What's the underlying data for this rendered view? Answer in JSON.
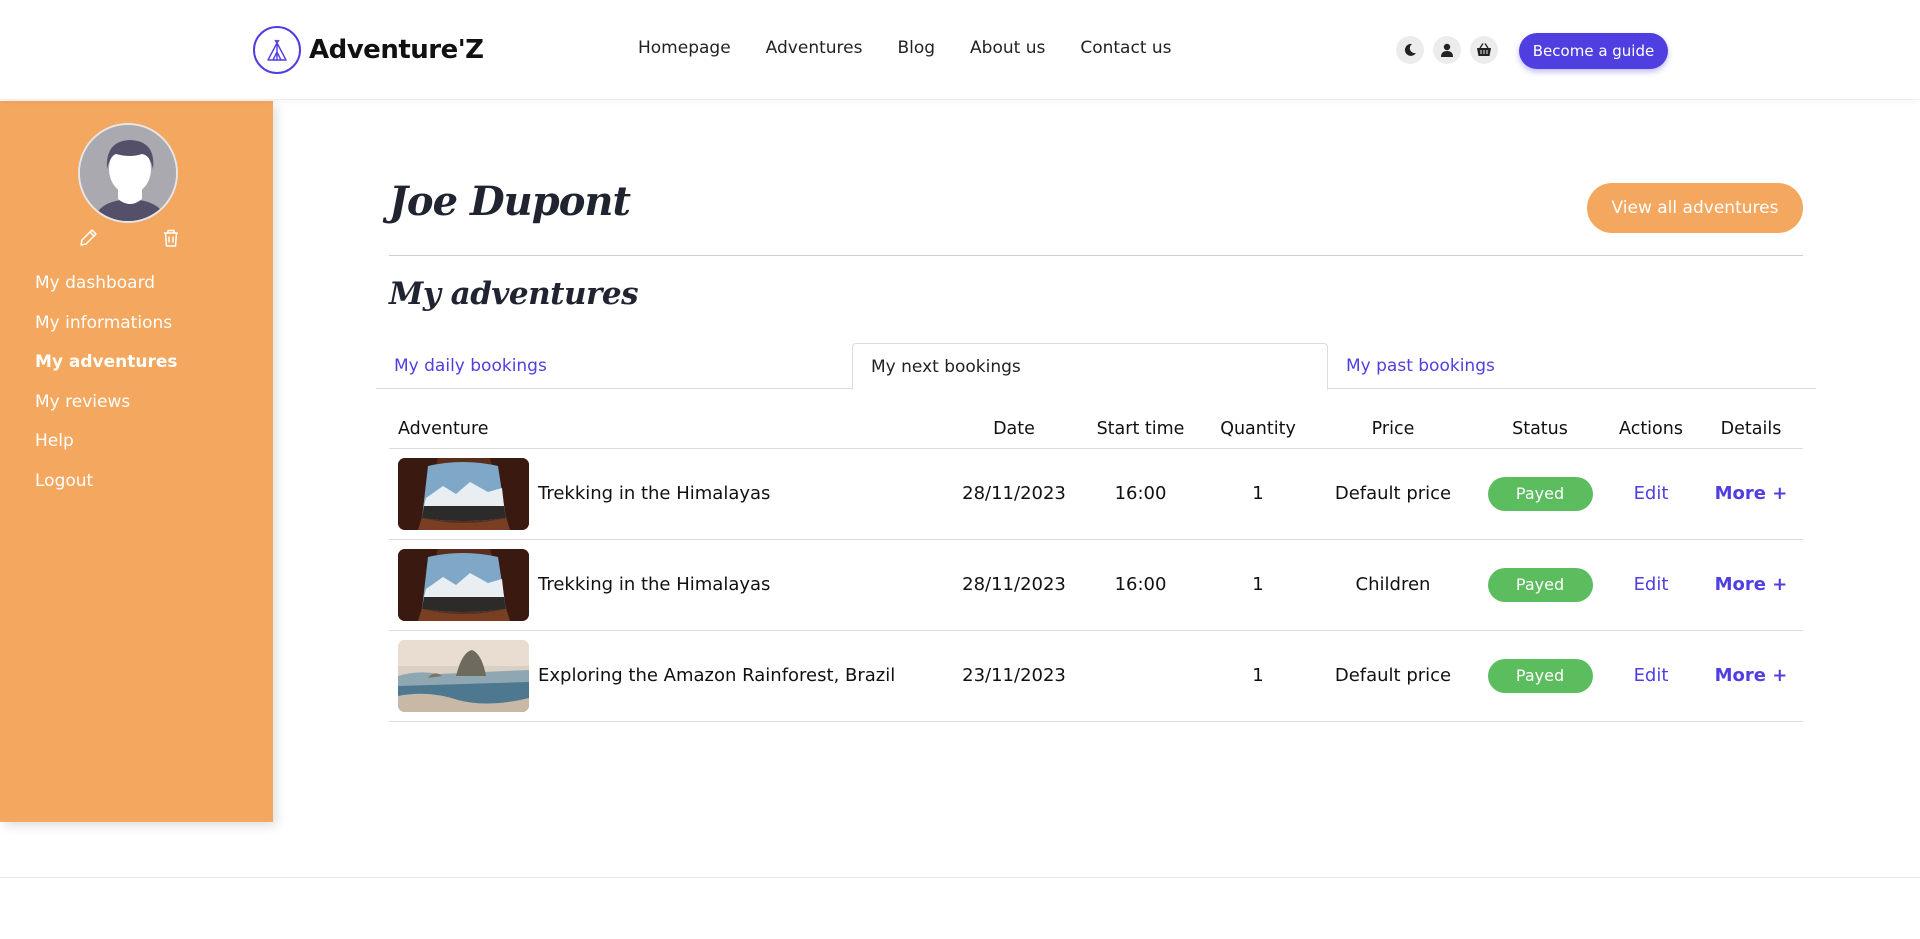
{
  "brand": {
    "name": "Adventure'Z",
    "accent": "#4f3fe0",
    "orange": "#f3a75f"
  },
  "nav": {
    "items": [
      "Homepage",
      "Adventures",
      "Blog",
      "About us",
      "Contact us"
    ]
  },
  "header_icons": [
    "moon-icon",
    "user-icon",
    "basket-icon"
  ],
  "cta": {
    "become_guide": "Become a guide"
  },
  "sidebar": {
    "items": [
      "My dashboard",
      "My informations",
      "My adventures",
      "My reviews",
      "Help",
      "Logout"
    ],
    "active": "My adventures"
  },
  "main": {
    "user_name": "Joe Dupont",
    "view_all": "View all adventures",
    "section_title": "My adventures",
    "tabs": [
      "My daily bookings",
      "My next bookings",
      "My past bookings"
    ],
    "active_tab": "My next bookings"
  },
  "table": {
    "headers": [
      "Adventure",
      "Date",
      "Start time",
      "Quantity",
      "Price",
      "Status",
      "Actions",
      "Details"
    ],
    "rows": [
      {
        "adventure": "Trekking in the Himalayas",
        "date": "28/11/2023",
        "start": "16:00",
        "qty": "1",
        "price": "Default price",
        "status": "Payed",
        "action": "Edit",
        "details": "More +"
      },
      {
        "adventure": "Trekking in the Himalayas",
        "date": "28/11/2023",
        "start": "16:00",
        "qty": "1",
        "price": "Children",
        "status": "Payed",
        "action": "Edit",
        "details": "More +"
      },
      {
        "adventure": "Exploring the Amazon Rainforest, Brazil",
        "date": "23/11/2023",
        "start": "",
        "qty": "1",
        "price": "Default price",
        "status": "Payed",
        "action": "Edit",
        "details": "More +"
      }
    ]
  }
}
